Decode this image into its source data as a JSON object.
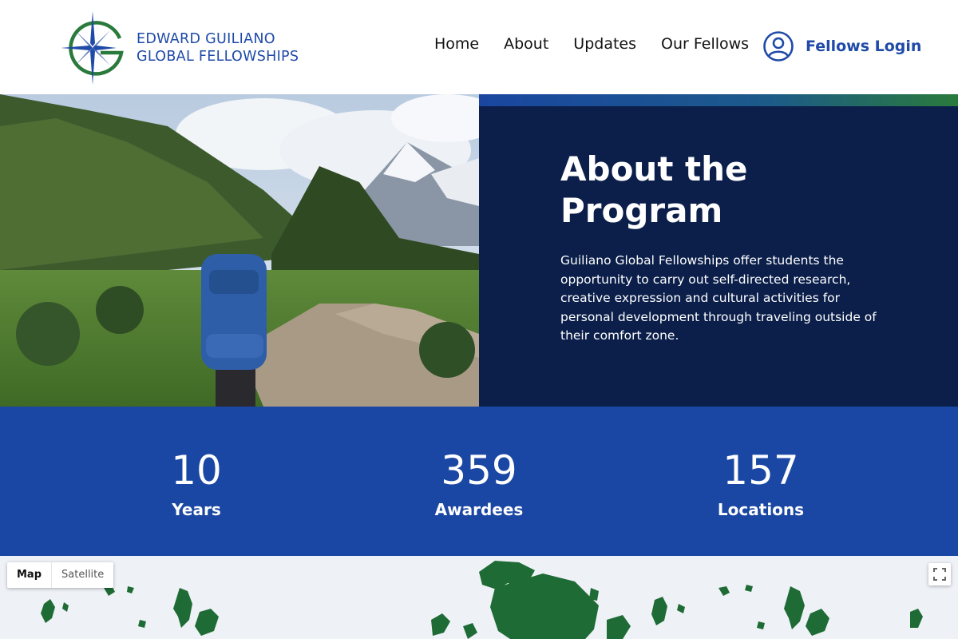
{
  "brand": {
    "line1": "EDWARD GUILIANO",
    "line2": "GLOBAL FELLOWSHIPS",
    "primary_color": "#1f4aa8",
    "accent_color": "#2a7a3c"
  },
  "nav": {
    "items": [
      "Home",
      "About",
      "Updates",
      "Our Fellows"
    ],
    "login_label": "Fellows Login",
    "login_icon": "user-circle-icon"
  },
  "hero": {
    "title": "About the Program",
    "body": "Guiliano Global Fellowships offer students the opportunity to carry out self-directed research, creative expression and cultural activities for personal development through traveling outside of their comfort zone.",
    "panel_color": "#0b1f4a"
  },
  "stats": [
    {
      "value": "10",
      "label": "Years"
    },
    {
      "value": "359",
      "label": "Awardees"
    },
    {
      "value": "157",
      "label": "Locations"
    }
  ],
  "map": {
    "map_label": "Map",
    "satellite_label": "Satellite",
    "selected": "Map",
    "land_color": "#1e6b35",
    "water_color": "#eef1f6"
  }
}
